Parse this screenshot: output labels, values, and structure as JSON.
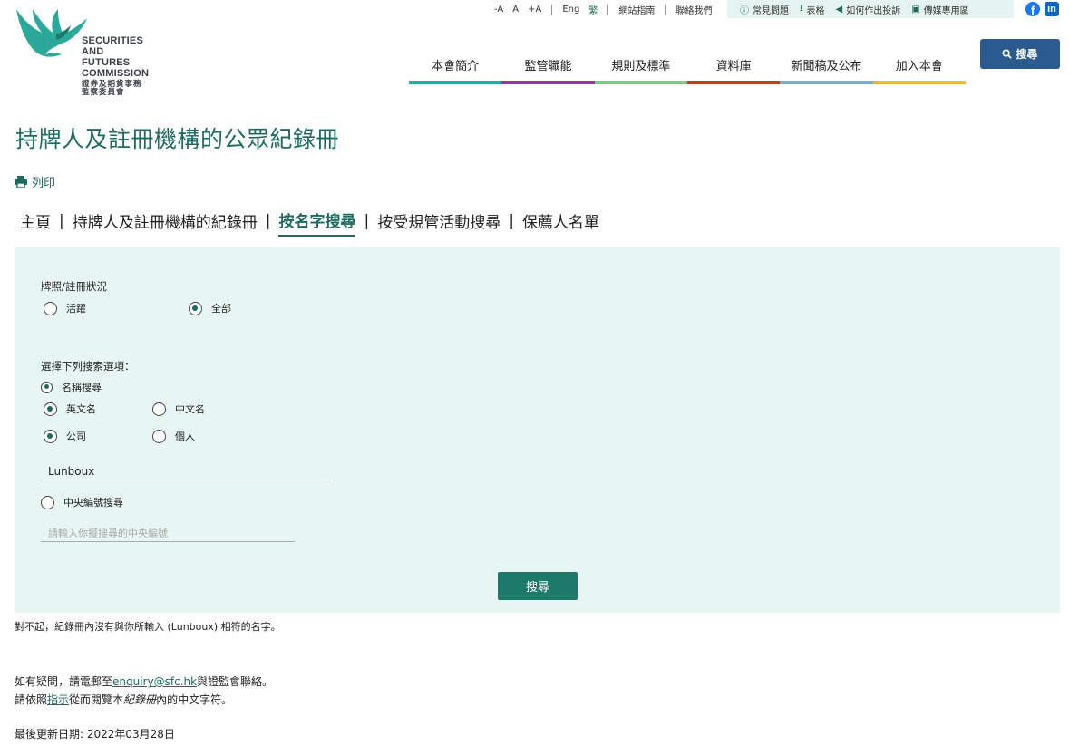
{
  "logo": {
    "line1": "SECURITIES AND",
    "line2": "FUTURES COMMISSION",
    "line3": "證券及期貨事務監察委員會"
  },
  "topbar": {
    "font_minus": "-A",
    "font_normal": "A",
    "font_plus": "+A",
    "lang_en": "Eng",
    "lang_sc": "繁",
    "sitemap": "網站指南",
    "contact": "聯絡我們"
  },
  "utilbar": {
    "faq": "常見問題",
    "forms": "表格",
    "complaint": "如何作出投訴",
    "media": "傳媒專用區"
  },
  "nav": [
    {
      "label": "本會簡介",
      "color": "#2aa89a"
    },
    {
      "label": "監管職能",
      "color": "#8b3fa3"
    },
    {
      "label": "規則及標準",
      "color": "#7fc68a"
    },
    {
      "label": "資料庫",
      "color": "#b5432a"
    },
    {
      "label": "新聞稿及公布",
      "color": "#7aaec8"
    },
    {
      "label": "加入本會",
      "color": "#e8b83c"
    }
  ],
  "search_button": "搜尋",
  "page_title": "持牌人及註冊機構的公眾紀錄冊",
  "print_label": "列印",
  "breadcrumb": {
    "home": "主頁",
    "register": "持牌人及註冊機構的紀錄冊",
    "by_name": "按名字搜尋",
    "by_activity": "按受規管活動搜尋",
    "sponsors": "保薦人名單"
  },
  "form": {
    "status_label": "牌照/註冊狀況",
    "status_active": "活躍",
    "status_all": "全部",
    "options_label": "選擇下列搜索選項：",
    "name_search": "名稱搜尋",
    "english_name": "英文名",
    "chinese_name": "中文名",
    "company": "公司",
    "individual": "個人",
    "name_value": "Lunboux",
    "ce_search": "中央編號搜尋",
    "ce_placeholder": "請輸入你擬搜尋的中央編號",
    "submit_label": "搜尋"
  },
  "result_message": "對不起，紀錄冊內沒有與你所輸入 (Lunboux) 相符的名字。",
  "contact": {
    "line1_prefix": "如有疑問，請電郵至",
    "email": "enquiry@sfc.hk",
    "line1_suffix": "與證監會聯絡。",
    "line2_prefix": "請依照",
    "instruction_link": "指示",
    "line2_mid": "從而閱覽本",
    "register_italic": "紀錄冊",
    "line2_suffix": "內的中文字符。"
  },
  "last_updated": "最後更新日期: 2022年03月28日",
  "colors": {
    "brand_green": "#1d6b5f",
    "panel_bg": "#e8f6f3",
    "search_blue": "#2a5a8e"
  }
}
